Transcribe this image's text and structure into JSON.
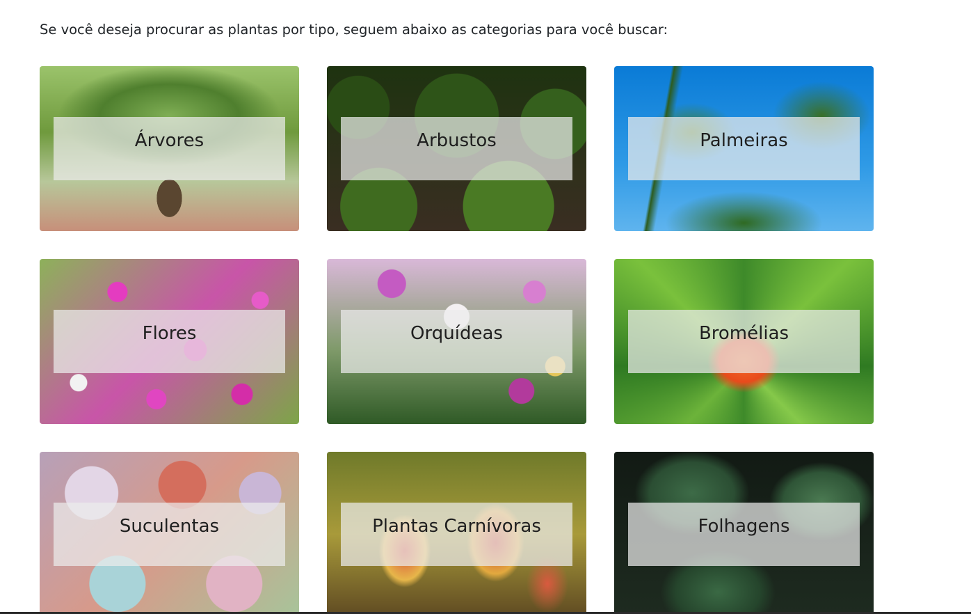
{
  "intro_text": "Se você deseja procurar as plantas por tipo, seguem abaixo as categorias para você buscar:",
  "categories": [
    {
      "label": "Árvores"
    },
    {
      "label": "Arbustos"
    },
    {
      "label": "Palmeiras"
    },
    {
      "label": "Flores"
    },
    {
      "label": "Orquídeas"
    },
    {
      "label": "Bromélias"
    },
    {
      "label": "Suculentas"
    },
    {
      "label": "Plantas Carnívoras"
    },
    {
      "label": "Folhagens"
    }
  ]
}
